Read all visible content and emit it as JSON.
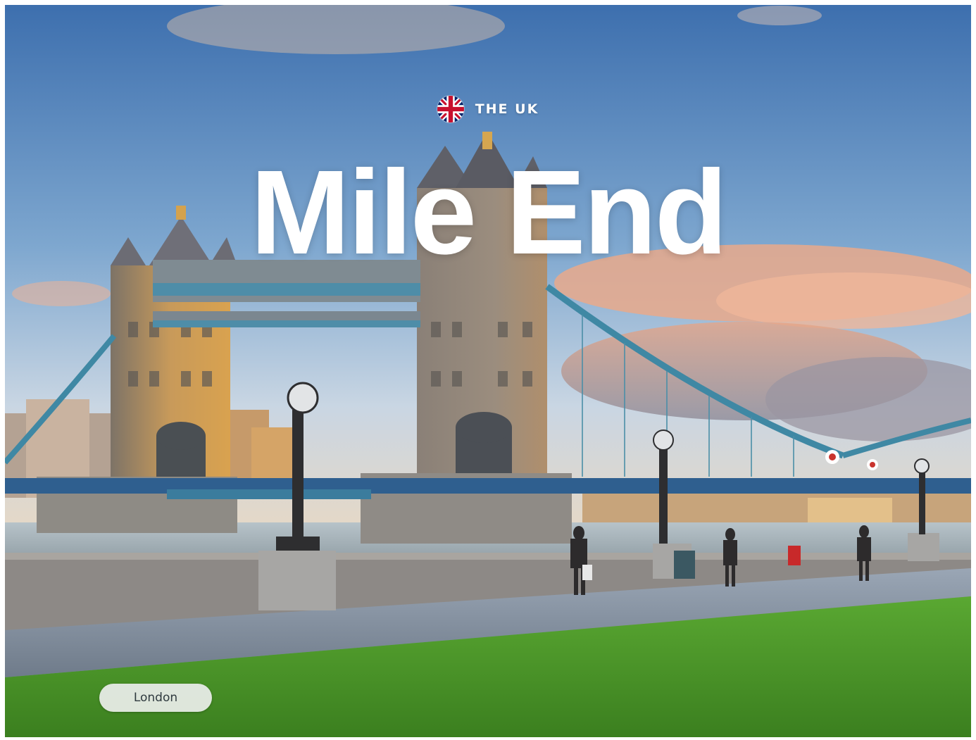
{
  "hero": {
    "country_label": "THE UK",
    "flag_icon": "uk-flag-icon",
    "title": "Mile End",
    "city_tag": "London"
  },
  "colors": {
    "sky_top": "#3f73b0",
    "sky_bottom": "#c5d8ea",
    "grass": "#4c9a2a",
    "bridge_steel": "#3d7e9a",
    "tower_stone": "#8f7d6a",
    "title_text": "#ffffff"
  }
}
